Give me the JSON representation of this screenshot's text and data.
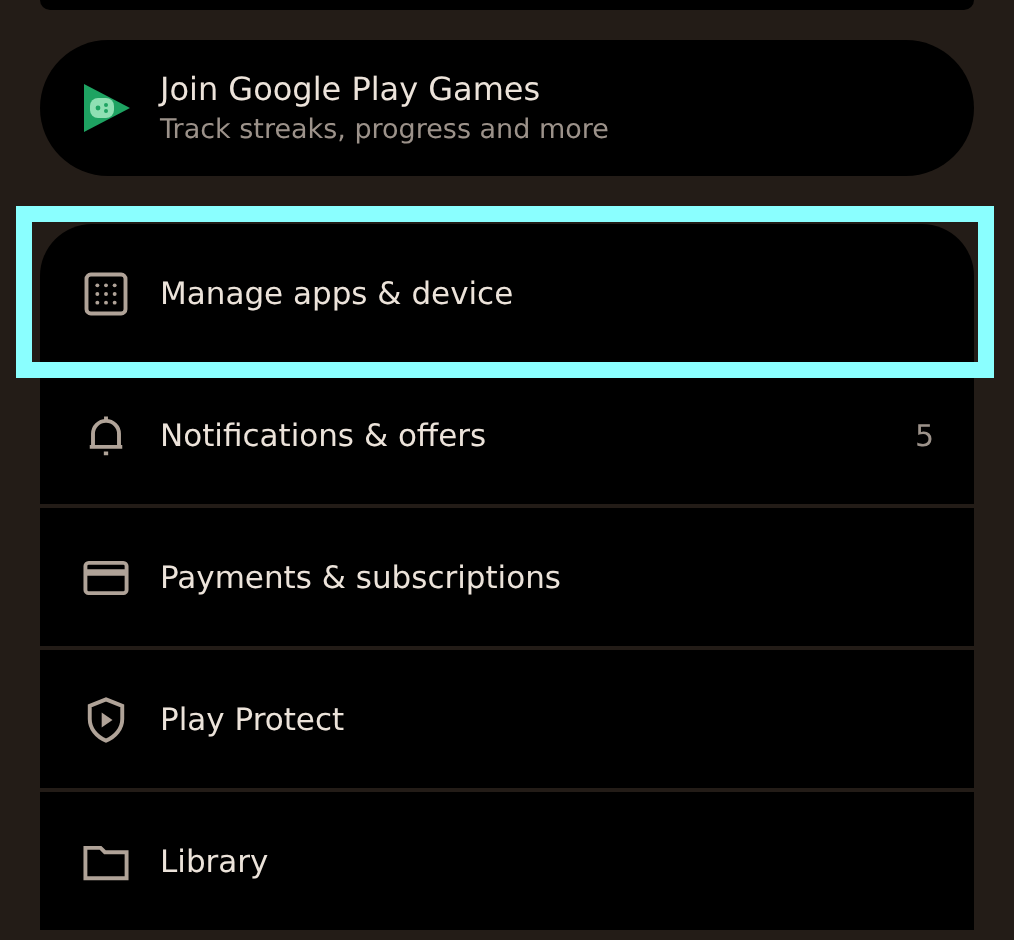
{
  "games_card": {
    "title": "Join Google Play Games",
    "subtitle": "Track streaks, progress and more"
  },
  "menu": [
    {
      "kind": "apps",
      "label": "Manage apps & device",
      "highlighted": true
    },
    {
      "kind": "bell",
      "label": "Notifications & offers",
      "count": "5",
      "highlighted": false
    },
    {
      "kind": "card",
      "label": "Payments & subscriptions",
      "highlighted": false
    },
    {
      "kind": "shield",
      "label": "Play Protect",
      "highlighted": false
    },
    {
      "kind": "folder",
      "label": "Library",
      "highlighted": false
    }
  ]
}
